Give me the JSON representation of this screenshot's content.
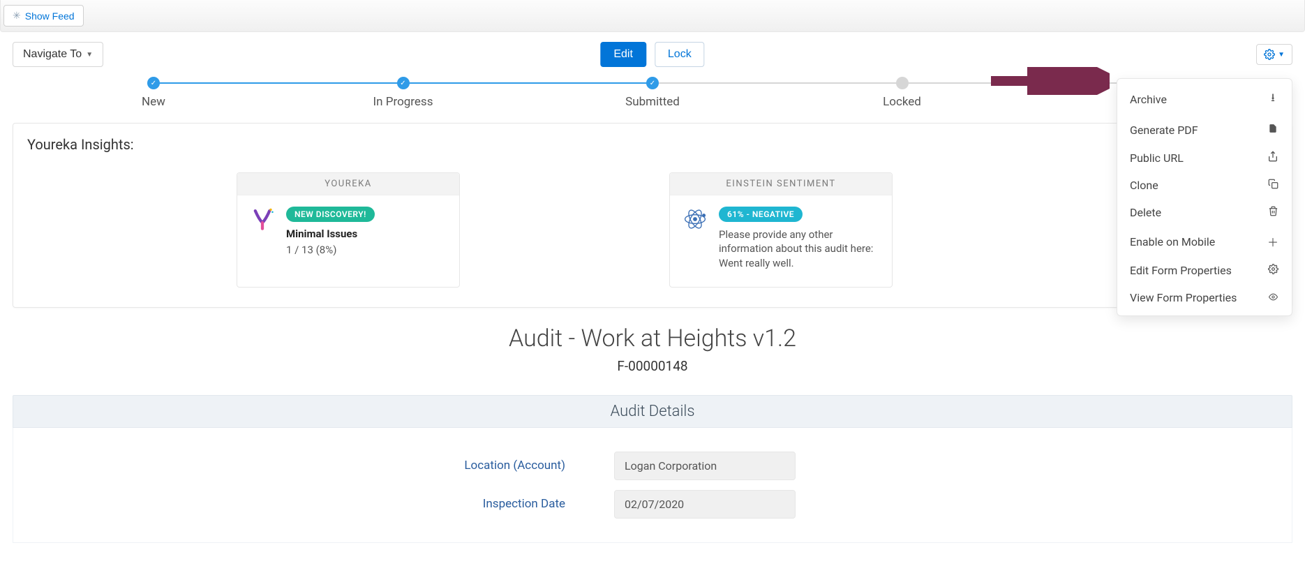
{
  "topbar": {
    "show_feed": "Show Feed"
  },
  "actions": {
    "navigate_to": "Navigate To",
    "edit": "Edit",
    "lock": "Lock"
  },
  "stages": {
    "s1": "New",
    "s2": "In Progress",
    "s3": "Submitted",
    "s4": "Locked"
  },
  "insights": {
    "title": "Youreka Insights:",
    "youreka": {
      "header": "YOUREKA",
      "badge": "NEW DISCOVERY!",
      "line1": "Minimal Issues",
      "line2": "1 / 13 (8%)"
    },
    "einstein": {
      "header": "EINSTEIN SENTIMENT",
      "badge": "61% - NEGATIVE",
      "text": "Please provide any other information about this audit here: Went really well."
    }
  },
  "gear_menu": {
    "archive": "Archive",
    "generate_pdf": "Generate PDF",
    "public_url": "Public URL",
    "clone": "Clone",
    "delete": "Delete",
    "enable_mobile": "Enable on Mobile",
    "edit_form_props": "Edit Form Properties",
    "view_form_props": "View Form Properties"
  },
  "title": {
    "main": "Audit - Work at Heights v1.2",
    "sub": "F-00000148"
  },
  "details": {
    "header": "Audit Details",
    "location_label": "Location (Account)",
    "location_value": "Logan Corporation",
    "inspection_label": "Inspection Date",
    "inspection_value": "02/07/2020"
  }
}
